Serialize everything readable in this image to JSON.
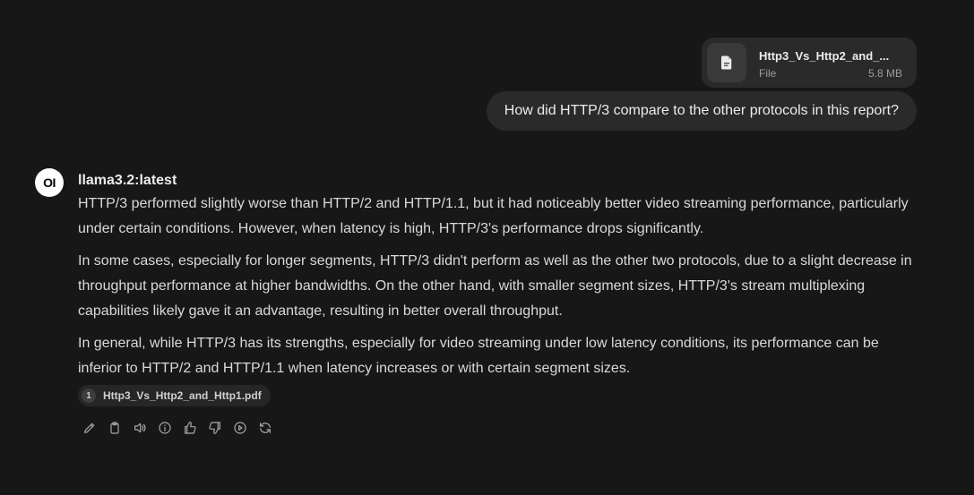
{
  "user": {
    "attachment": {
      "name": "Http3_Vs_Http2_and_...",
      "type": "File",
      "size": "5.8 MB",
      "icon": "document-icon"
    },
    "message": "How did HTTP/3 compare to the other protocols in this report?"
  },
  "assistant": {
    "avatar_text": "OI",
    "model": "llama3.2:latest",
    "paragraphs": [
      "HTTP/3 performed slightly worse than HTTP/2 and HTTP/1.1, but it had noticeably better video streaming performance, particularly under certain conditions. However, when latency is high, HTTP/3's performance drops significantly.",
      "In some cases, especially for longer segments, HTTP/3 didn't perform as well as the other two protocols, due to a slight decrease in throughput performance at higher bandwidths. On the other hand, with smaller segment sizes, HTTP/3's stream multiplexing capabilities likely gave it an advantage, resulting in better overall throughput.",
      "In general, while HTTP/3 has its strengths, especially for video streaming under low latency conditions, its performance can be inferior to HTTP/2 and HTTP/1.1 when latency increases or with certain segment sizes."
    ],
    "citation": {
      "number": "1",
      "label": "Http3_Vs_Http2_and_Http1.pdf"
    },
    "actions": [
      "edit-icon",
      "copy-icon",
      "read-aloud-icon",
      "info-icon",
      "thumbs-up-icon",
      "thumbs-down-icon",
      "continue-icon",
      "regenerate-icon"
    ]
  },
  "colors": {
    "background": "#171717",
    "bubble": "#2a2a2a",
    "text": "#ececec",
    "muted": "#9b9b9b"
  }
}
